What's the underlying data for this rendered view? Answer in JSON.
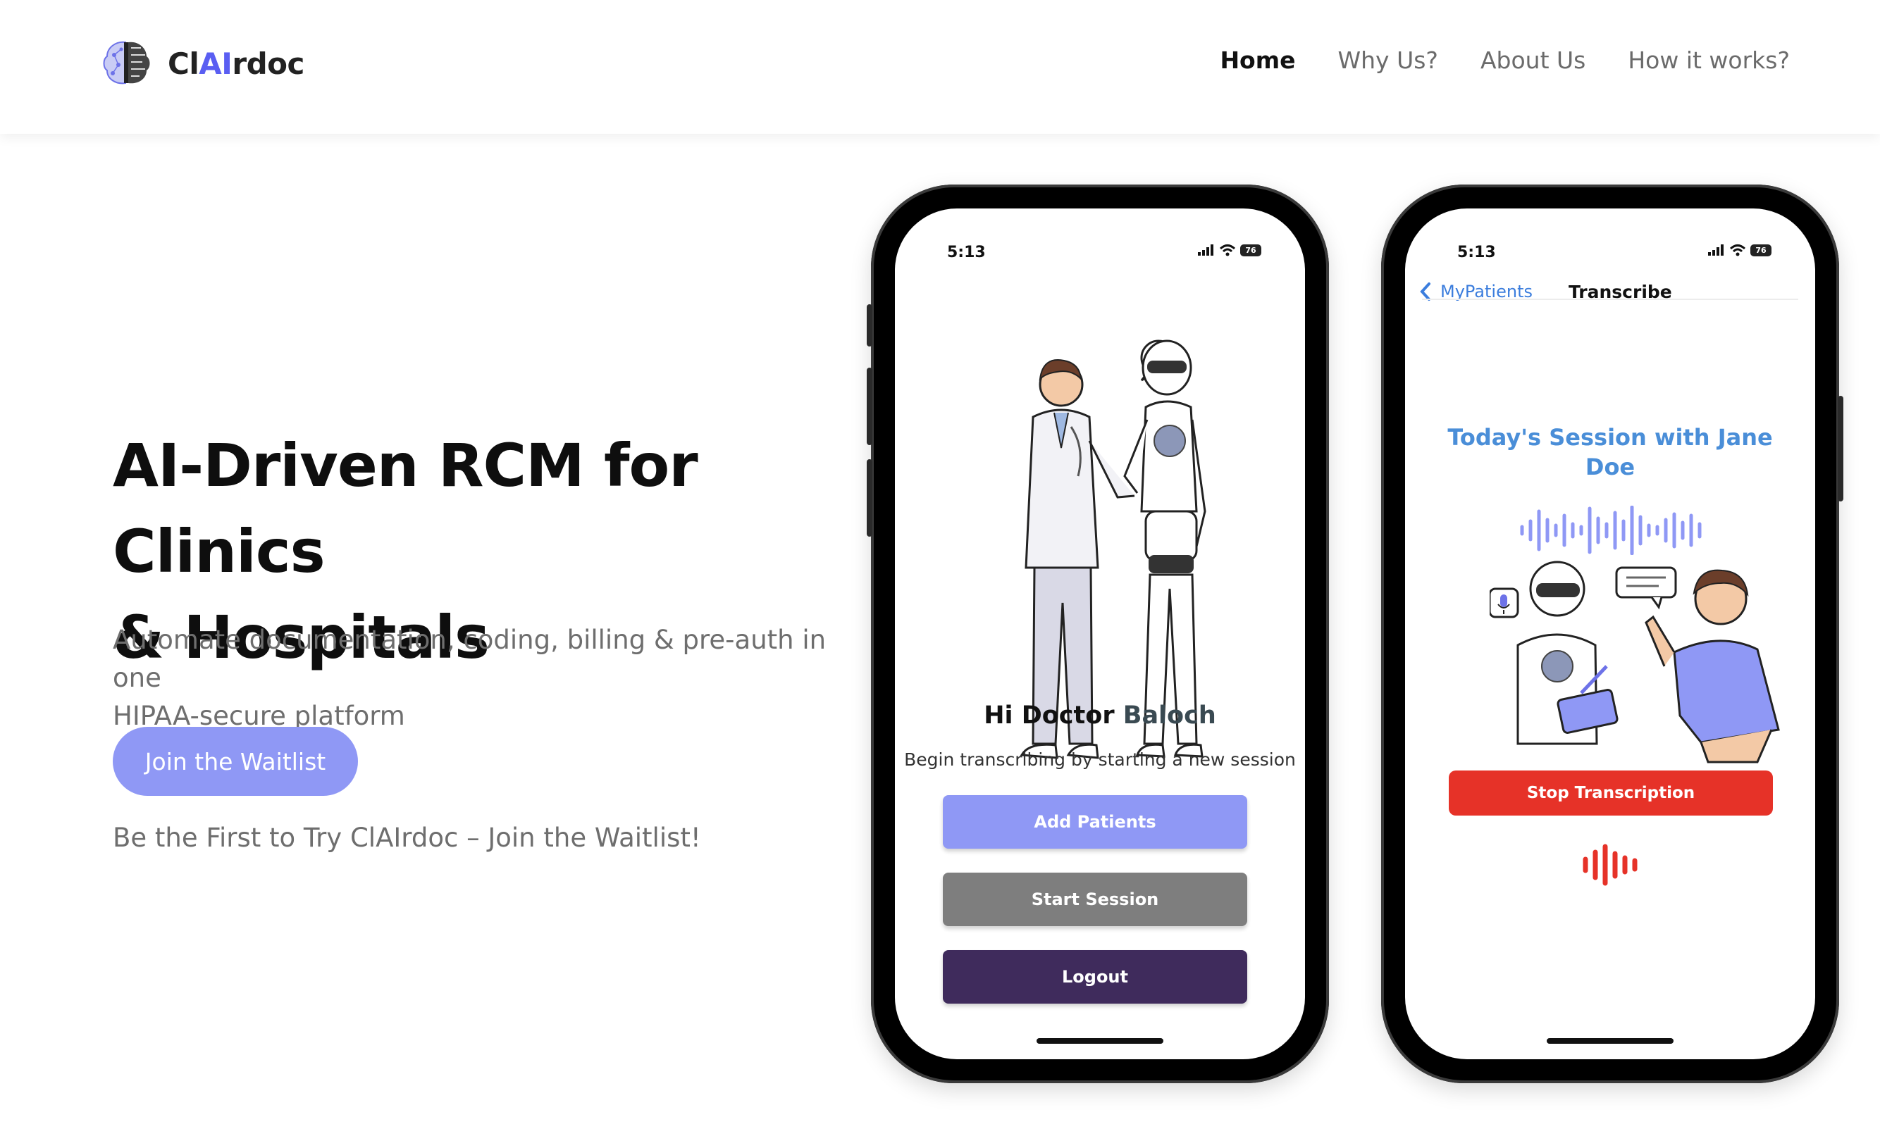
{
  "brand": {
    "name_prefix": "Cl",
    "name_ai": "AI",
    "name_suffix": "rdoc",
    "accent_color": "#5a5ef2",
    "icon": "brain-chip-logo-icon"
  },
  "nav": {
    "items": [
      {
        "label": "Home",
        "active": true
      },
      {
        "label": "Why Us?",
        "active": false
      },
      {
        "label": "About Us",
        "active": false
      },
      {
        "label": "How it works?",
        "active": false
      }
    ]
  },
  "hero": {
    "title_line1": "AI-Driven RCM for Clinics",
    "title_line2": "& Hospitals",
    "subtitle_line1": "Automate documentation, coding, billing & pre-auth in one",
    "subtitle_line2": "HIPAA-secure platform",
    "cta_label": "Join the Waitlist",
    "cta_color": "#8f98f5",
    "note": "Be the First to Try ClAIrdoc – Join the Waitlist!"
  },
  "phone_left": {
    "time": "5:13",
    "battery": "76",
    "greeting": "Hi Doctor",
    "doctor_name": "Baloch",
    "hint": "Begin transcribing by starting a new session",
    "buttons": {
      "add_patients": "Add Patients",
      "start_session": "Start Session",
      "logout": "Logout"
    },
    "colors": {
      "add": "#8f98f5",
      "start": "#7e7e7e",
      "logout": "#3f2b5c"
    }
  },
  "phone_right": {
    "time": "5:13",
    "battery": "76",
    "back_label": "MyPatients",
    "screen_title": "Transcribe",
    "session_line1": "Today's Session with Jane",
    "session_line2": "Doe",
    "stop_label": "Stop Transcription",
    "colors": {
      "session_title": "#4a8ed8",
      "stop": "#e63228",
      "wave": "#8f98f5"
    }
  }
}
